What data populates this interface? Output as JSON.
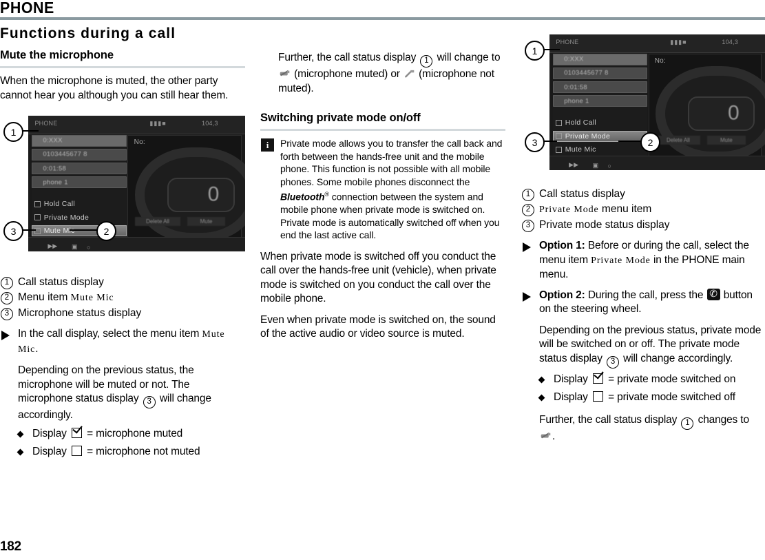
{
  "header": {
    "running_title": "PHONE"
  },
  "folio": "182",
  "left_column": {
    "chapter_heading": "Functions during a call",
    "section_heading": "Mute the microphone",
    "intro": "When the microphone is muted, the other party cannot hear you although you can still hear them.",
    "figure": {
      "screen_title": "PHONE",
      "status_right": "104,3",
      "rows": [
        "0:XXX",
        "0103445677 8",
        "0:01:58",
        "phone 1"
      ],
      "menu_items": [
        "Hold Call",
        "Private Mode",
        "Mute Mic"
      ],
      "right_pane_label": "No:",
      "keypad_digit": "0",
      "softkeys": [
        "Delete All",
        "Mute"
      ],
      "callouts": [
        "1",
        "2",
        "3"
      ]
    },
    "legend": [
      {
        "num": "1",
        "text": "Call status display"
      },
      {
        "num": "2",
        "text_before": "Menu item ",
        "ui_text": "Mute Mic",
        "text_after": ""
      },
      {
        "num": "3",
        "text": "Microphone status display"
      }
    ],
    "action": {
      "text_before": "In the call display, select the menu item ",
      "ui_text": "Mute Mic",
      "text_after": "."
    },
    "followup": "Depending on the previous status, the microphone will be muted or not. The microphone status display",
    "followup_after": "will change accordingly.",
    "followup_ref": "3",
    "bullets": [
      {
        "prefix": "Display",
        "glyph": "checkbox-checked",
        "suffix": "= microphone muted"
      },
      {
        "prefix": "Display",
        "glyph": "checkbox-empty",
        "suffix": "= microphone not muted"
      }
    ]
  },
  "middle_column": {
    "para_further_before": "Further, the call status display",
    "para_further_ref": "1",
    "para_further_mid": "will change to",
    "para_further_muted": "(microphone muted) or",
    "para_further_end": "(microphone not muted).",
    "section_heading": "Switching private mode on/off",
    "note": {
      "icon": "info-icon",
      "part1": "Private mode allows you to transfer the call back and forth between the hands-free unit and the mobile phone. This function is not possible with all mobile phones. Some mobile phones disconnect the ",
      "brand": "Bluetooth",
      "registered": "®",
      "part2": " connection between the system and mobile phone when private mode is switched on. Private mode is automatically switched off when you end the last active call."
    },
    "para_off_on": "When private mode is switched off you conduct the call over the hands-free unit (vehicle), when private mode is switched on you conduct the call over the mobile phone.",
    "para_even": "Even when private mode is switched on, the sound of the active audio or video source is muted."
  },
  "right_column": {
    "figure": {
      "screen_title": "PHONE",
      "status_right": "104,3",
      "rows": [
        "0:XXX",
        "0103445677 8",
        "0:01:58",
        "phone 1"
      ],
      "menu_items": [
        "Hold Call",
        "Private Mode",
        "Mute Mic"
      ],
      "right_pane_label": "No:",
      "keypad_digit": "0",
      "softkeys": [
        "Delete All",
        "Mute"
      ],
      "callouts": [
        "1",
        "2",
        "3"
      ]
    },
    "legend": [
      {
        "num": "1",
        "text": "Call status display"
      },
      {
        "num": "2",
        "ui_text": "Private Mode",
        "text_after": " menu item"
      },
      {
        "num": "3",
        "text": "Private mode status display"
      }
    ],
    "option1": {
      "label": "Option 1:",
      "text_before": " Before or during the call, select the menu item ",
      "ui_text": "Private Mode",
      "text_after": " in the PHONE main menu."
    },
    "option2": {
      "label": "Option 2:",
      "text_before": " During the call, press the ",
      "glyph": "phone-button-icon",
      "text_after": " button on the steering wheel."
    },
    "followup": "Depending on the previous status, private mode will be switched on or off. The private mode status display",
    "followup_after": "will change accordingly.",
    "followup_ref": "3",
    "bullets": [
      {
        "prefix": "Display",
        "glyph": "checkbox-checked",
        "suffix": "= private mode switched on"
      },
      {
        "prefix": "Display",
        "glyph": "checkbox-empty",
        "suffix": "= private mode switched off"
      }
    ],
    "final_before": "Further, the call status display",
    "final_ref": "1",
    "final_after": "changes to",
    "final_end": "."
  },
  "colors": {
    "header_rule": "#8a9aa0",
    "section_rule": "#d3d9dc",
    "screen_bg": "#1a1a1a"
  }
}
